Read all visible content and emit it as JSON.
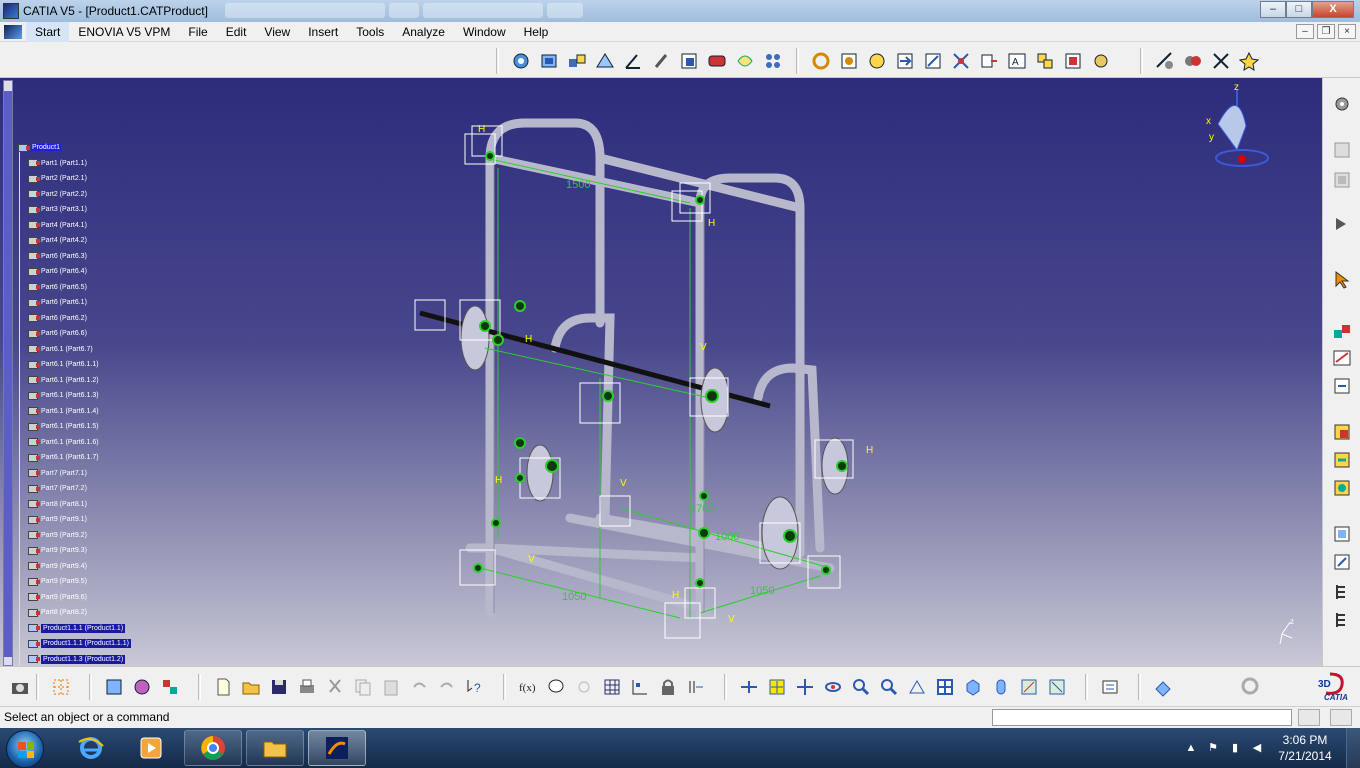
{
  "window": {
    "title": "CATIA V5 - [Product1.CATProduct]",
    "controls": {
      "minimize": "–",
      "maximize": "□",
      "close": "X"
    }
  },
  "menu": {
    "items": [
      {
        "label": "Start",
        "name": "menu-start"
      },
      {
        "label": "ENOVIA V5 VPM",
        "name": "menu-enovia"
      },
      {
        "label": "File",
        "name": "menu-file"
      },
      {
        "label": "Edit",
        "name": "menu-edit"
      },
      {
        "label": "View",
        "name": "menu-view"
      },
      {
        "label": "Insert",
        "name": "menu-insert"
      },
      {
        "label": "Tools",
        "name": "menu-tools"
      },
      {
        "label": "Analyze",
        "name": "menu-analyze"
      },
      {
        "label": "Window",
        "name": "menu-window"
      },
      {
        "label": "Help",
        "name": "menu-help"
      }
    ],
    "mdi_controls": [
      "–",
      "❐",
      "×"
    ]
  },
  "tree": {
    "root": "Product1",
    "items": [
      "Part1 (Part1.1)",
      "Part2 (Part2.1)",
      "Part2 (Part2.2)",
      "Part3 (Part3.1)",
      "Part4 (Part4.1)",
      "Part4 (Part4.2)",
      "Part6 (Part6.3)",
      "Part6 (Part6.4)",
      "Part6 (Part6.5)",
      "Part6 (Part6.1)",
      "Part6 (Part6.2)",
      "Part6 (Part6.6)",
      "Part6.1 (Part6.7)",
      "Part6.1 (Part6.1.1)",
      "Part6.1 (Part6.1.2)",
      "Part6.1 (Part6.1.3)",
      "Part6.1 (Part6.1.4)",
      "Part6.1 (Part6.1.5)",
      "Part6.1 (Part6.1.6)",
      "Part6.1 (Part6.1.7)",
      "Part7 (Part7.1)",
      "Part7 (Part7.2)",
      "Part8 (Part8.1)",
      "Part9 (Part9.1)",
      "Part9 (Part9.2)",
      "Part9 (Part9.3)",
      "Part9 (Part9.4)",
      "Part9 (Part9.5)",
      "Part9 (Part9.6)",
      "Part8 (Part8.2)"
    ],
    "products": [
      "Product1.1.1 (Product1.1)",
      "Product1.1.1 (Product1.1.1)",
      "Product1.1.3 (Product1.2)"
    ]
  },
  "model": {
    "dimensions": [
      "1500",
      "1700",
      "1000",
      "1050",
      "1050"
    ],
    "axis_labels": {
      "x": "x",
      "y": "y",
      "z": "z"
    },
    "constraint_marks": [
      "H",
      "V",
      "H",
      "V"
    ]
  },
  "toolbars": {
    "top_icons": [
      "assembly-constraint-icon",
      "coincidence-icon",
      "contact-icon",
      "offset-icon",
      "angle-icon",
      "fix-icon",
      "fix-together-icon",
      "quick-constraint-icon",
      "flexible-icon",
      "reuse-pattern-icon",
      "update-icon",
      "components-icon",
      "existing-component-icon",
      "replace-icon",
      "graph-tree-icon",
      "generate-numbering-icon",
      "selective-load-icon",
      "manage-representations-icon",
      "multi-instantiation-icon",
      "fast-multi-instantiation-icon",
      "bill-of-material-icon",
      "space-analysis-icon",
      "measure-icon",
      "clash-icon",
      "sectioning-icon"
    ],
    "bottom_icons": [
      "capture-icon",
      "grid-icon",
      "catalog-icon",
      "materials-icon",
      "apply-material-icon",
      "new-icon",
      "open-icon",
      "save-icon",
      "print-icon",
      "cut-icon",
      "copy-icon",
      "paste-icon",
      "undo-icon",
      "redo-icon",
      "whats-this-icon",
      "formula-icon",
      "knowledge-icon",
      "design-table-icon",
      "table-icon",
      "law-icon",
      "lock-icon",
      "constraint-icon",
      "fly-mode-icon",
      "fit-all-icon",
      "pan-icon",
      "rotate-icon",
      "zoom-in-icon",
      "zoom-out-icon",
      "normal-view-icon",
      "multi-view-icon",
      "iso-view-icon",
      "shading-icon",
      "hide-show-icon",
      "swap-visible-icon",
      "apply-settings-icon",
      "analysis-icon",
      "cycle-icon"
    ],
    "right_icons": [
      "gear-icon",
      "part-design-icon",
      "product-icon",
      "move-icon",
      "select-icon",
      "constraints-icon",
      "snap-icon",
      "explode-icon",
      "compass-icon",
      "manipulate-icon",
      "product-structure-icon",
      "catalog-browser-icon",
      "tree-icon",
      "reorder-icon",
      "section-icon"
    ]
  },
  "status": {
    "message": "Select an object or a command",
    "command_input": ""
  },
  "taskbar": {
    "apps": [
      "start-orb",
      "internet-explorer-icon",
      "media-player-icon",
      "chrome-icon",
      "file-explorer-icon",
      "catia-icon"
    ],
    "time": "3:06 PM",
    "date": "7/21/2014"
  },
  "colors": {
    "viewport_top": "#2c2c7c",
    "viewport_bottom": "#c8c8d6",
    "constraint_green": "#2ecc2e",
    "constraint_yellow": "#ffff00",
    "tube_color": "#b8b8cc"
  }
}
